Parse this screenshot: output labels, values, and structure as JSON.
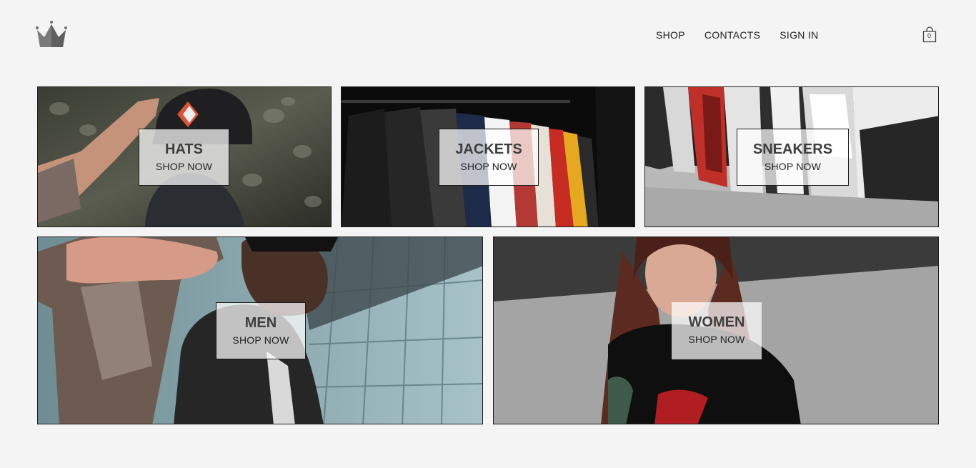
{
  "header": {
    "logo_icon": "crown-icon",
    "nav": {
      "shop": "SHOP",
      "contacts": "CONTACTS",
      "sign_in": "SIGN IN"
    },
    "cart": {
      "icon": "shopping-bag-icon",
      "count": "0"
    }
  },
  "categories": [
    {
      "title": "HATS",
      "cta": "SHOP NOW"
    },
    {
      "title": "JACKETS",
      "cta": "SHOP NOW"
    },
    {
      "title": "SNEAKERS",
      "cta": "SHOP NOW"
    },
    {
      "title": "MEN",
      "cta": "SHOP NOW"
    },
    {
      "title": "WOMEN",
      "cta": "SHOP NOW"
    }
  ],
  "colors": {
    "background": "#f4f4f4",
    "text": "#222222",
    "title_text": "#3e3e3e",
    "border": "#1d1d1d"
  }
}
